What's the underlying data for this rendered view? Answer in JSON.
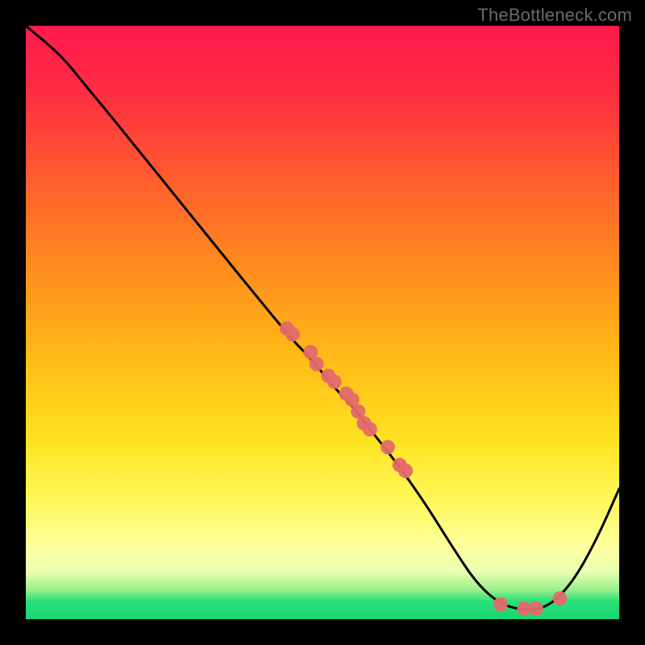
{
  "watermark": "TheBottleneck.com",
  "chart_data": {
    "type": "line",
    "title": "",
    "xlabel": "",
    "ylabel": "",
    "xlim": [
      0,
      100
    ],
    "ylim": [
      0,
      100
    ],
    "curve": [
      {
        "x": 0,
        "y": 100
      },
      {
        "x": 6,
        "y": 95
      },
      {
        "x": 10,
        "y": 90
      },
      {
        "x": 15,
        "y": 84
      },
      {
        "x": 44,
        "y": 48
      },
      {
        "x": 48,
        "y": 44
      },
      {
        "x": 52,
        "y": 39
      },
      {
        "x": 55,
        "y": 36
      },
      {
        "x": 58,
        "y": 32
      },
      {
        "x": 62,
        "y": 27
      },
      {
        "x": 67,
        "y": 20
      },
      {
        "x": 72,
        "y": 12
      },
      {
        "x": 76,
        "y": 6
      },
      {
        "x": 80,
        "y": 2.5
      },
      {
        "x": 84,
        "y": 1.5
      },
      {
        "x": 88,
        "y": 2
      },
      {
        "x": 92,
        "y": 6
      },
      {
        "x": 96,
        "y": 13
      },
      {
        "x": 100,
        "y": 22
      }
    ],
    "marker_up": [
      {
        "x": 44,
        "y": 49
      },
      {
        "x": 45,
        "y": 48
      },
      {
        "x": 48,
        "y": 45
      },
      {
        "x": 49,
        "y": 43
      },
      {
        "x": 51,
        "y": 41
      },
      {
        "x": 52,
        "y": 40
      },
      {
        "x": 54,
        "y": 38
      },
      {
        "x": 55,
        "y": 37
      },
      {
        "x": 56,
        "y": 35
      },
      {
        "x": 57,
        "y": 33
      },
      {
        "x": 58,
        "y": 32
      },
      {
        "x": 61,
        "y": 29
      },
      {
        "x": 63,
        "y": 26
      },
      {
        "x": 64,
        "y": 25
      }
    ],
    "marker_bottom": [
      {
        "x": 80,
        "y": 2.5
      },
      {
        "x": 84,
        "y": 1.8
      },
      {
        "x": 86,
        "y": 1.8
      },
      {
        "x": 90,
        "y": 3.5
      }
    ]
  }
}
